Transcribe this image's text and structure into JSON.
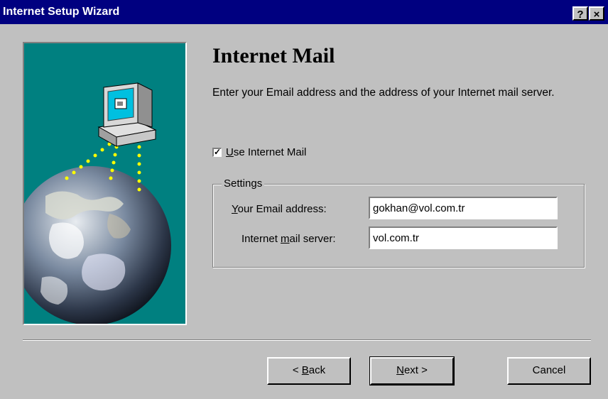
{
  "window": {
    "title": "Internet Setup Wizard",
    "help_label": "?",
    "close_label": "×"
  },
  "page": {
    "heading": "Internet Mail",
    "description": "Enter your Email address and the address of your Internet mail server."
  },
  "use_mail": {
    "checked": true,
    "check_mark": "✓",
    "label_first": "U",
    "label_rest": "se Internet Mail"
  },
  "settings": {
    "legend": "Settings",
    "email_label_first": "Y",
    "email_label_rest": "our Email address:",
    "email_value": "gokhan@vol.com.tr",
    "server_label_pre": "Internet ",
    "server_label_u": "m",
    "server_label_rest": "ail server:",
    "server_value": "vol.com.tr"
  },
  "buttons": {
    "back_arrow": "< ",
    "back_u": "B",
    "back_rest": "ack",
    "next_u": "N",
    "next_rest": "ext",
    "next_arrow": " >",
    "cancel": "Cancel"
  },
  "colors": {
    "titlebar": "#000080",
    "panel": "#008080",
    "dialog": "#c0c0c0",
    "dots": "#ffff00"
  },
  "icons": [
    "computer-icon",
    "earth-image",
    "help-icon",
    "close-icon"
  ]
}
